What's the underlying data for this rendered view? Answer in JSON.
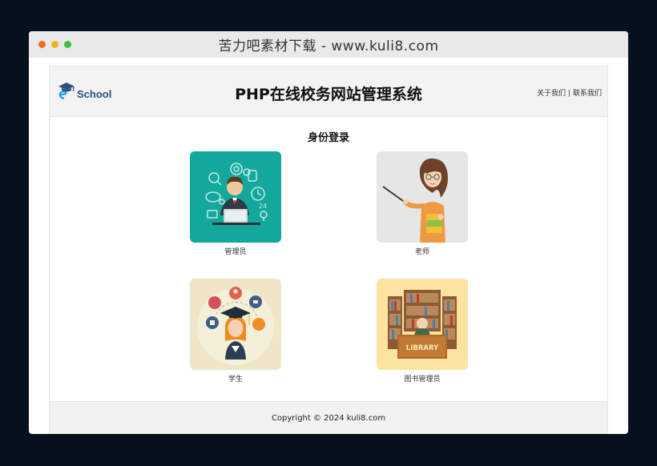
{
  "window": {
    "title": "苦力吧素材下载 - www.kuli8.com"
  },
  "header": {
    "logo_text": "School",
    "site_title": "PHP在线校务网站管理系统",
    "links": [
      "关于我们",
      "联系我们"
    ],
    "link_separator": "|"
  },
  "main": {
    "section_title": "身份登录",
    "roles": [
      {
        "label": "管理员",
        "icon": "admin-icon",
        "bg": "#14a79c"
      },
      {
        "label": "老师",
        "icon": "teacher-icon",
        "bg": "#e6e6e6"
      },
      {
        "label": "学生",
        "icon": "student-icon",
        "bg": "#efe6c8"
      },
      {
        "label": "图书管理员",
        "icon": "librarian-icon",
        "bg": "#fce3a0"
      }
    ]
  },
  "footer": {
    "copyright": "Copyright © 2024 kuli8.com"
  },
  "colors": {
    "background": "#07111d",
    "header_bg": "#f3f3f3",
    "footer_bg": "#f2f2f2",
    "logo": "#2c4f7c"
  }
}
